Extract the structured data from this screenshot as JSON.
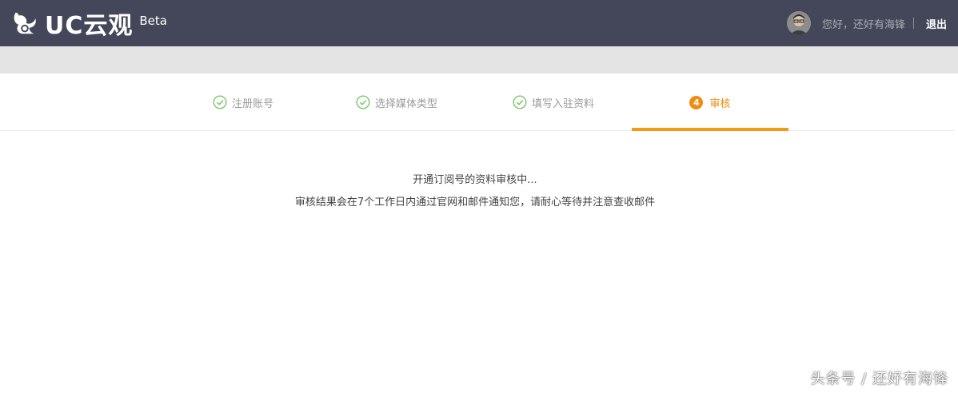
{
  "header": {
    "brand": "UC云观",
    "beta": "Beta",
    "greeting": "您好，还好有海锋",
    "logout": "退出",
    "bg_color": "#434759"
  },
  "steps": [
    {
      "label": "注册账号",
      "status": "done"
    },
    {
      "label": "选择媒体类型",
      "status": "done"
    },
    {
      "label": "填写入驻资料",
      "status": "done"
    },
    {
      "label": "审核",
      "number": "4",
      "status": "active"
    }
  ],
  "accent": "#f08d0e",
  "message": {
    "line1": "开通订阅号的资料审核中...",
    "line2": "审核结果会在7个工作日内通过官网和邮件通知您，请耐心等待并注意查收邮件"
  },
  "watermark": "头条号 / 还好有海锋"
}
